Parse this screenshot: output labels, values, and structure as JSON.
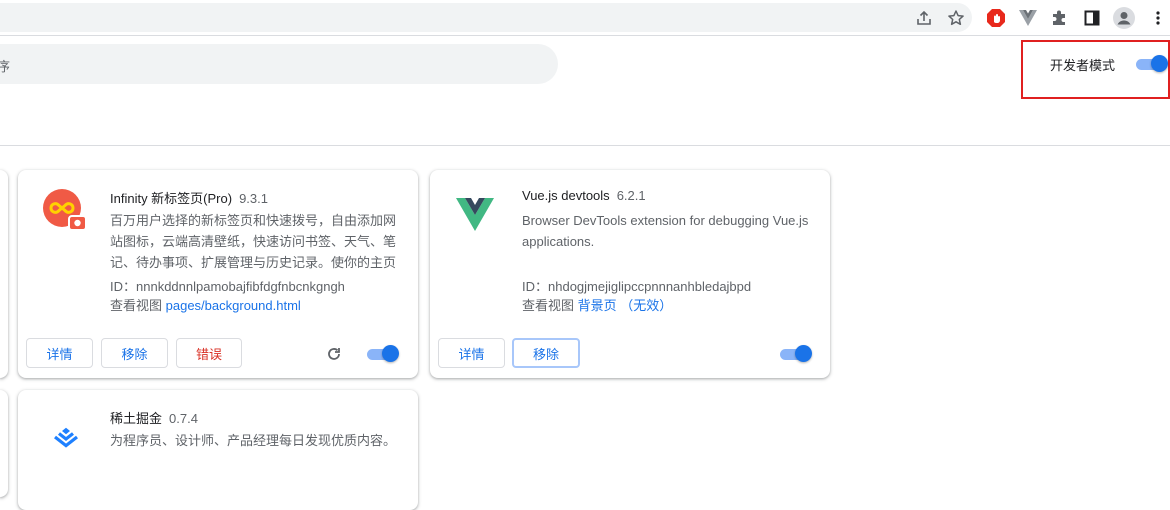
{
  "header": {
    "developer_mode_label": "开发者模式",
    "developer_mode_enabled": true,
    "search_fragment": "序"
  },
  "extensions": [
    {
      "name": "Infinity 新标签页(Pro)",
      "version": "9.3.1",
      "description": "百万用户选择的新标签页和快速拨号，自由添加网站图标，云端高清壁纸，快速访问书签、天气、笔记、待办事项、扩展管理与历史记录。使你的主页个性化可视化的又手",
      "id_label": "ID：",
      "id": "nnnkddnnlpamobajfibfdgfnbcnkgngh",
      "views_label": "查看视图",
      "view_link": "pages/background.html",
      "buttons": {
        "details": "详情",
        "remove": "移除",
        "errors": "错误"
      },
      "enabled": true
    },
    {
      "name": "Vue.js devtools",
      "version": "6.2.1",
      "description": "Browser DevTools extension for debugging Vue.js applications.",
      "id_label": "ID：",
      "id": "nhdogjmejiglipccpnnnanhbledajbpd",
      "views_label": "查看视图",
      "view_link": "背景页 （无效）",
      "buttons": {
        "details": "详情",
        "remove": "移除"
      },
      "enabled": true
    },
    {
      "name": "稀土掘金",
      "version": "0.7.4",
      "description": "为程序员、设计师、产品经理每日发现优质内容。"
    }
  ],
  "colors": {
    "accent": "#1a73e8",
    "toggle_track": "#8ab4f8",
    "error_text": "#d93025",
    "highlight_box": "#e02020",
    "vue_green": "#41b883",
    "vue_dark": "#35495e",
    "infinity_red": "#f05a45",
    "juejin_blue": "#1e80ff"
  },
  "icons": [
    "share-icon",
    "star-icon",
    "adblock-icon",
    "vue-devtools-icon",
    "extensions-puzzle-icon",
    "side-panel-icon",
    "profile-avatar-icon",
    "kebab-menu-icon"
  ]
}
